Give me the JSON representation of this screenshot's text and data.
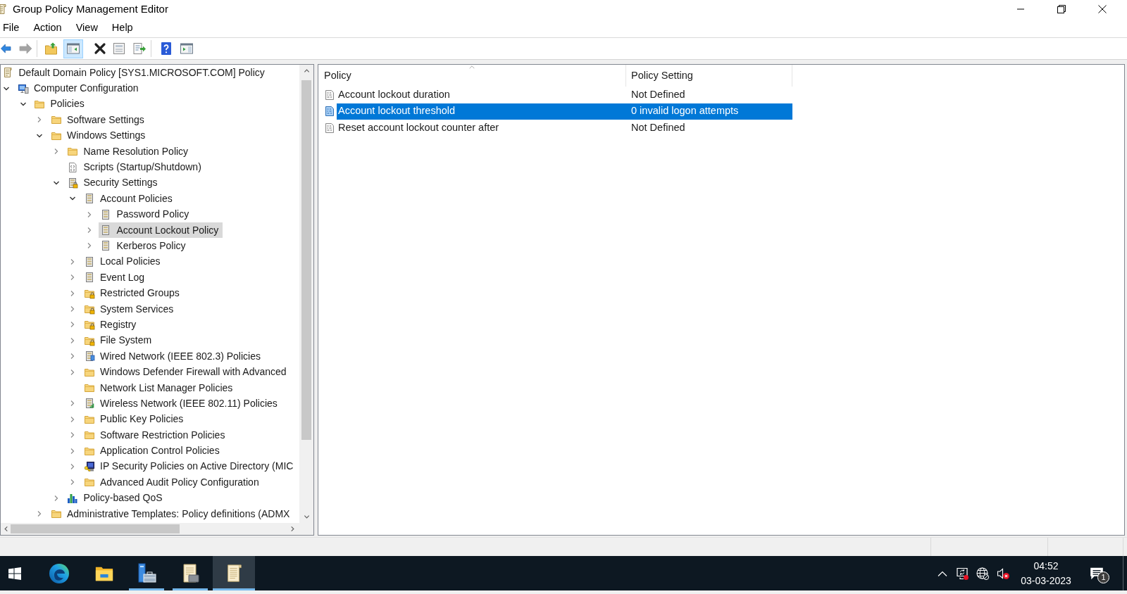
{
  "window": {
    "title": "Group Policy Management Editor"
  },
  "menu": [
    "File",
    "Action",
    "View",
    "Help"
  ],
  "toolbar": [
    [
      {
        "kind": "back",
        "pressed": false,
        "disabled": false
      },
      {
        "kind": "forward",
        "pressed": false,
        "disabled": true
      }
    ],
    [
      {
        "kind": "up",
        "pressed": false,
        "disabled": false
      },
      {
        "kind": "tree",
        "pressed": true,
        "disabled": false
      },
      {
        "kind": "delete",
        "pressed": false,
        "disabled": false
      },
      {
        "kind": "properties",
        "pressed": false,
        "disabled": false
      },
      {
        "kind": "export",
        "pressed": false,
        "disabled": false
      }
    ],
    [
      {
        "kind": "help",
        "pressed": false,
        "disabled": false
      },
      {
        "kind": "actions",
        "pressed": false,
        "disabled": false
      }
    ]
  ],
  "tree": [
    {
      "label": "Default Domain Policy [SYS1.MICROSOFT.COM] Policy",
      "kind": "document",
      "selected": false,
      "children": [
        {
          "label": "Computer Configuration",
          "kind": "computer",
          "expanded": true,
          "selected": false,
          "children": [
            {
              "label": "Policies",
              "kind": "folder",
              "expanded": true,
              "selected": false,
              "children": [
                {
                  "label": "Software Settings",
                  "kind": "folder",
                  "expanded": false,
                  "selected": false
                },
                {
                  "label": "Windows Settings",
                  "kind": "folder",
                  "expanded": true,
                  "selected": false,
                  "children": [
                    {
                      "label": "Name Resolution Policy",
                      "kind": "folder",
                      "expanded": false,
                      "selected": false
                    },
                    {
                      "label": "Scripts (Startup/Shutdown)",
                      "kind": "script",
                      "selected": false
                    },
                    {
                      "label": "Security Settings",
                      "kind": "security",
                      "expanded": true,
                      "selected": false,
                      "children": [
                        {
                          "label": "Account Policies",
                          "kind": "settings",
                          "expanded": true,
                          "selected": false,
                          "children": [
                            {
                              "label": "Password Policy",
                              "kind": "settings",
                              "expanded": false,
                              "selected": false
                            },
                            {
                              "label": "Account Lockout Policy",
                              "kind": "settings",
                              "expanded": false,
                              "selected": true
                            },
                            {
                              "label": "Kerberos Policy",
                              "kind": "settings",
                              "expanded": false,
                              "selected": false
                            }
                          ]
                        },
                        {
                          "label": "Local Policies",
                          "kind": "settings",
                          "expanded": false,
                          "selected": false
                        },
                        {
                          "label": "Event Log",
                          "kind": "settings",
                          "expanded": false,
                          "selected": false
                        },
                        {
                          "label": "Restricted Groups",
                          "kind": "secured",
                          "expanded": false,
                          "selected": false
                        },
                        {
                          "label": "System Services",
                          "kind": "secured",
                          "expanded": false,
                          "selected": false
                        },
                        {
                          "label": "Registry",
                          "kind": "secured",
                          "expanded": false,
                          "selected": false
                        },
                        {
                          "label": "File System",
                          "kind": "secured",
                          "expanded": false,
                          "selected": false
                        },
                        {
                          "label": "Wired Network (IEEE 802.3) Policies",
                          "kind": "wired",
                          "expanded": false,
                          "selected": false
                        },
                        {
                          "label": "Windows Defender Firewall with Advanced",
                          "kind": "folder",
                          "expanded": false,
                          "selected": false
                        },
                        {
                          "label": "Network List Manager Policies",
                          "kind": "folder",
                          "selected": false
                        },
                        {
                          "label": "Wireless Network (IEEE 802.11) Policies",
                          "kind": "wireless",
                          "expanded": false,
                          "selected": false
                        },
                        {
                          "label": "Public Key Policies",
                          "kind": "folder",
                          "expanded": false,
                          "selected": false
                        },
                        {
                          "label": "Software Restriction Policies",
                          "kind": "folder",
                          "expanded": false,
                          "selected": false
                        },
                        {
                          "label": "Application Control Policies",
                          "kind": "folder",
                          "expanded": false,
                          "selected": false
                        },
                        {
                          "label": "IP Security Policies on Active Directory (MIC",
                          "kind": "ipsec",
                          "expanded": false,
                          "selected": false
                        },
                        {
                          "label": "Advanced Audit Policy Configuration",
                          "kind": "folder",
                          "expanded": false,
                          "selected": false
                        }
                      ]
                    },
                    {
                      "label": "Policy-based QoS",
                      "kind": "chart",
                      "expanded": false,
                      "selected": false
                    }
                  ]
                },
                {
                  "label": "Administrative Templates: Policy definitions (ADMX",
                  "kind": "folder",
                  "expanded": false,
                  "selected": false
                }
              ]
            }
          ]
        }
      ]
    }
  ],
  "list": {
    "columns": [
      {
        "label": "Policy",
        "sorted": true
      },
      {
        "label": "Policy Setting",
        "sorted": false
      }
    ],
    "rows": [
      {
        "cells": [
          "Account lockout duration",
          "Not Defined"
        ],
        "selected": false
      },
      {
        "cells": [
          "Account lockout threshold",
          "0 invalid logon attempts"
        ],
        "selected": true
      },
      {
        "cells": [
          "Reset account lockout counter after",
          "Not Defined"
        ],
        "selected": false
      }
    ]
  },
  "taskbar": {
    "apps": [
      {
        "kind": "browser",
        "running": false,
        "selected": false
      },
      {
        "kind": "files",
        "running": false,
        "selected": false
      },
      {
        "kind": "server",
        "running": true,
        "selected": false
      },
      {
        "kind": "console",
        "running": true,
        "selected": false
      },
      {
        "kind": "editor",
        "running": true,
        "selected": true
      }
    ],
    "clock": {
      "time": "04:52",
      "date": "03-03-2023"
    },
    "notification_count": "1"
  }
}
